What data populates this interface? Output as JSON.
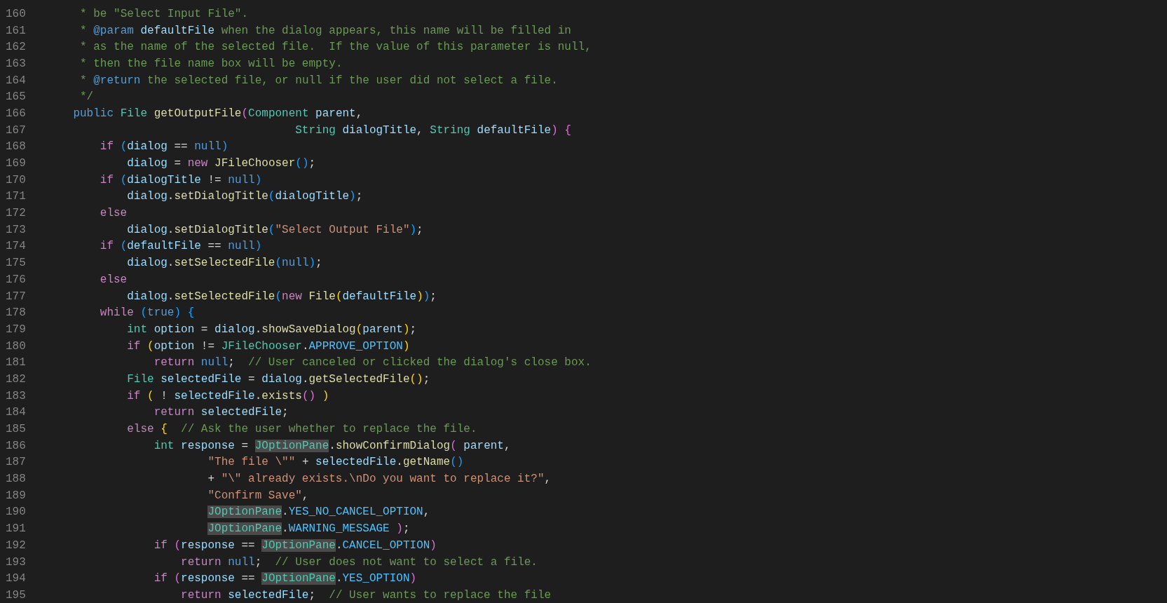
{
  "editor": {
    "lines": [
      {
        "number": "160",
        "tokens": [
          {
            "kind": "comment",
            "text": "     * be \"Select Input File\"."
          }
        ]
      },
      {
        "number": "161",
        "tokens": [
          {
            "kind": "comment",
            "text": "     * "
          },
          {
            "kind": "doc-tag",
            "text": "@param"
          },
          {
            "kind": "variable",
            "text": " defaultFile"
          },
          {
            "kind": "comment",
            "text": " when the dialog appears, this name will be filled in"
          }
        ]
      },
      {
        "number": "162",
        "tokens": [
          {
            "kind": "comment",
            "text": "     * as the name of the selected file.  If the value of this parameter is null,"
          }
        ]
      },
      {
        "number": "163",
        "tokens": [
          {
            "kind": "comment",
            "text": "     * then the file name box will be empty."
          }
        ]
      },
      {
        "number": "164",
        "tokens": [
          {
            "kind": "comment",
            "text": "     * "
          },
          {
            "kind": "doc-tag",
            "text": "@return"
          },
          {
            "kind": "comment",
            "text": " the selected file, or null if the user did not select a file."
          }
        ]
      },
      {
        "number": "165",
        "tokens": [
          {
            "kind": "comment",
            "text": "     */"
          }
        ]
      },
      {
        "number": "166",
        "tokens": [
          {
            "kind": "literal",
            "text": "    public"
          },
          {
            "kind": "type",
            "text": " File"
          },
          {
            "kind": "function",
            "text": " getOutputFile"
          },
          {
            "kind": "bracket-2",
            "text": "("
          },
          {
            "kind": "type",
            "text": "Component"
          },
          {
            "kind": "variable",
            "text": " parent"
          },
          {
            "kind": "plain",
            "text": ","
          }
        ]
      },
      {
        "number": "167",
        "tokens": [
          {
            "kind": "type",
            "text": "                                     String"
          },
          {
            "kind": "variable",
            "text": " dialogTitle"
          },
          {
            "kind": "plain",
            "text": ","
          },
          {
            "kind": "type",
            "text": " String"
          },
          {
            "kind": "variable",
            "text": " defaultFile"
          },
          {
            "kind": "bracket-2",
            "text": ")"
          },
          {
            "kind": "bracket-2",
            "text": " {"
          }
        ]
      },
      {
        "number": "168",
        "tokens": [
          {
            "kind": "keyword",
            "text": "        if"
          },
          {
            "kind": "bracket-3",
            "text": " ("
          },
          {
            "kind": "variable",
            "text": "dialog"
          },
          {
            "kind": "plain",
            "text": " == "
          },
          {
            "kind": "literal",
            "text": "null"
          },
          {
            "kind": "bracket-3",
            "text": ")"
          }
        ]
      },
      {
        "number": "169",
        "tokens": [
          {
            "kind": "variable",
            "text": "            dialog"
          },
          {
            "kind": "plain",
            "text": " = "
          },
          {
            "kind": "keyword",
            "text": "new"
          },
          {
            "kind": "function",
            "text": " JFileChooser"
          },
          {
            "kind": "bracket-3",
            "text": "()"
          },
          {
            "kind": "plain",
            "text": ";"
          }
        ]
      },
      {
        "number": "170",
        "tokens": [
          {
            "kind": "keyword",
            "text": "        if"
          },
          {
            "kind": "bracket-3",
            "text": " ("
          },
          {
            "kind": "variable",
            "text": "dialogTitle"
          },
          {
            "kind": "plain",
            "text": " != "
          },
          {
            "kind": "literal",
            "text": "null"
          },
          {
            "kind": "bracket-3",
            "text": ")"
          }
        ]
      },
      {
        "number": "171",
        "tokens": [
          {
            "kind": "variable",
            "text": "            dialog"
          },
          {
            "kind": "plain",
            "text": "."
          },
          {
            "kind": "function",
            "text": "setDialogTitle"
          },
          {
            "kind": "bracket-3",
            "text": "("
          },
          {
            "kind": "variable",
            "text": "dialogTitle"
          },
          {
            "kind": "bracket-3",
            "text": ")"
          },
          {
            "kind": "plain",
            "text": ";"
          }
        ]
      },
      {
        "number": "172",
        "tokens": [
          {
            "kind": "keyword",
            "text": "        else"
          }
        ]
      },
      {
        "number": "173",
        "tokens": [
          {
            "kind": "variable",
            "text": "            dialog"
          },
          {
            "kind": "plain",
            "text": "."
          },
          {
            "kind": "function",
            "text": "setDialogTitle"
          },
          {
            "kind": "bracket-3",
            "text": "("
          },
          {
            "kind": "string",
            "text": "\"Select Output File\""
          },
          {
            "kind": "bracket-3",
            "text": ")"
          },
          {
            "kind": "plain",
            "text": ";"
          }
        ]
      },
      {
        "number": "174",
        "tokens": [
          {
            "kind": "keyword",
            "text": "        if"
          },
          {
            "kind": "bracket-3",
            "text": " ("
          },
          {
            "kind": "variable",
            "text": "defaultFile"
          },
          {
            "kind": "plain",
            "text": " == "
          },
          {
            "kind": "literal",
            "text": "null"
          },
          {
            "kind": "bracket-3",
            "text": ")"
          }
        ]
      },
      {
        "number": "175",
        "tokens": [
          {
            "kind": "variable",
            "text": "            dialog"
          },
          {
            "kind": "plain",
            "text": "."
          },
          {
            "kind": "function",
            "text": "setSelectedFile"
          },
          {
            "kind": "bracket-3",
            "text": "("
          },
          {
            "kind": "literal",
            "text": "null"
          },
          {
            "kind": "bracket-3",
            "text": ")"
          },
          {
            "kind": "plain",
            "text": ";"
          }
        ]
      },
      {
        "number": "176",
        "tokens": [
          {
            "kind": "keyword",
            "text": "        else"
          }
        ]
      },
      {
        "number": "177",
        "tokens": [
          {
            "kind": "variable",
            "text": "            dialog"
          },
          {
            "kind": "plain",
            "text": "."
          },
          {
            "kind": "function",
            "text": "setSelectedFile"
          },
          {
            "kind": "bracket-3",
            "text": "("
          },
          {
            "kind": "keyword",
            "text": "new"
          },
          {
            "kind": "function",
            "text": " File"
          },
          {
            "kind": "bracket-1",
            "text": "("
          },
          {
            "kind": "variable",
            "text": "defaultFile"
          },
          {
            "kind": "bracket-1",
            "text": ")"
          },
          {
            "kind": "bracket-3",
            "text": ")"
          },
          {
            "kind": "plain",
            "text": ";"
          }
        ]
      },
      {
        "number": "178",
        "tokens": [
          {
            "kind": "keyword",
            "text": "        while"
          },
          {
            "kind": "bracket-3",
            "text": " ("
          },
          {
            "kind": "literal",
            "text": "true"
          },
          {
            "kind": "bracket-3",
            "text": ")"
          },
          {
            "kind": "bracket-3",
            "text": " {"
          }
        ]
      },
      {
        "number": "179",
        "tokens": [
          {
            "kind": "type",
            "text": "            int"
          },
          {
            "kind": "variable",
            "text": " option"
          },
          {
            "kind": "plain",
            "text": " = "
          },
          {
            "kind": "variable",
            "text": "dialog"
          },
          {
            "kind": "plain",
            "text": "."
          },
          {
            "kind": "function",
            "text": "showSaveDialog"
          },
          {
            "kind": "bracket-1",
            "text": "("
          },
          {
            "kind": "variable",
            "text": "parent"
          },
          {
            "kind": "bracket-1",
            "text": ")"
          },
          {
            "kind": "plain",
            "text": ";"
          }
        ]
      },
      {
        "number": "180",
        "tokens": [
          {
            "kind": "keyword",
            "text": "            if"
          },
          {
            "kind": "bracket-1",
            "text": " ("
          },
          {
            "kind": "variable",
            "text": "option"
          },
          {
            "kind": "plain",
            "text": " != "
          },
          {
            "kind": "type",
            "text": "JFileChooser"
          },
          {
            "kind": "plain",
            "text": "."
          },
          {
            "kind": "constant",
            "text": "APPROVE_OPTION"
          },
          {
            "kind": "bracket-1",
            "text": ")"
          }
        ]
      },
      {
        "number": "181",
        "tokens": [
          {
            "kind": "keyword",
            "text": "                return"
          },
          {
            "kind": "literal",
            "text": " null"
          },
          {
            "kind": "plain",
            "text": ";"
          },
          {
            "kind": "comment",
            "text": "  // User canceled or clicked the dialog's close box."
          }
        ]
      },
      {
        "number": "182",
        "tokens": [
          {
            "kind": "type",
            "text": "            File"
          },
          {
            "kind": "variable",
            "text": " selectedFile"
          },
          {
            "kind": "plain",
            "text": " = "
          },
          {
            "kind": "variable",
            "text": "dialog"
          },
          {
            "kind": "plain",
            "text": "."
          },
          {
            "kind": "function",
            "text": "getSelectedFile"
          },
          {
            "kind": "bracket-1",
            "text": "()"
          },
          {
            "kind": "plain",
            "text": ";"
          }
        ]
      },
      {
        "number": "183",
        "tokens": [
          {
            "kind": "keyword",
            "text": "            if"
          },
          {
            "kind": "bracket-1",
            "text": " ("
          },
          {
            "kind": "plain",
            "text": " ! "
          },
          {
            "kind": "variable",
            "text": "selectedFile"
          },
          {
            "kind": "plain",
            "text": "."
          },
          {
            "kind": "function",
            "text": "exists"
          },
          {
            "kind": "bracket-2",
            "text": "()"
          },
          {
            "kind": "bracket-1",
            "text": " )"
          }
        ]
      },
      {
        "number": "184",
        "tokens": [
          {
            "kind": "keyword",
            "text": "                return"
          },
          {
            "kind": "variable",
            "text": " selectedFile"
          },
          {
            "kind": "plain",
            "text": ";"
          }
        ]
      },
      {
        "number": "185",
        "tokens": [
          {
            "kind": "keyword",
            "text": "            else"
          },
          {
            "kind": "bracket-1",
            "text": " {"
          },
          {
            "kind": "comment",
            "text": "  // Ask the user whether to replace the file."
          }
        ]
      },
      {
        "number": "186",
        "tokens": [
          {
            "kind": "type",
            "text": "                int"
          },
          {
            "kind": "variable",
            "text": " response"
          },
          {
            "kind": "plain",
            "text": " = "
          },
          {
            "kind": "match",
            "text": "JOptionPane"
          },
          {
            "kind": "plain",
            "text": "."
          },
          {
            "kind": "function",
            "text": "showConfirmDialog"
          },
          {
            "kind": "bracket-2",
            "text": "("
          },
          {
            "kind": "variable",
            "text": " parent"
          },
          {
            "kind": "plain",
            "text": ","
          }
        ]
      },
      {
        "number": "187",
        "tokens": [
          {
            "kind": "string",
            "text": "                        \"The file \\\"\""
          },
          {
            "kind": "plain",
            "text": " + "
          },
          {
            "kind": "variable",
            "text": "selectedFile"
          },
          {
            "kind": "plain",
            "text": "."
          },
          {
            "kind": "function",
            "text": "getName"
          },
          {
            "kind": "bracket-3",
            "text": "()"
          }
        ]
      },
      {
        "number": "188",
        "tokens": [
          {
            "kind": "plain",
            "text": "                        + "
          },
          {
            "kind": "string",
            "text": "\"\\\" already exists.\\nDo you want to replace it?\""
          },
          {
            "kind": "plain",
            "text": ","
          }
        ]
      },
      {
        "number": "189",
        "tokens": [
          {
            "kind": "string",
            "text": "                        \"Confirm Save\""
          },
          {
            "kind": "plain",
            "text": ","
          }
        ]
      },
      {
        "number": "190",
        "tokens": [
          {
            "kind": "match",
            "text": "                        JOptionPane"
          },
          {
            "kind": "plain",
            "text": "."
          },
          {
            "kind": "constant",
            "text": "YES_NO_CANCEL_OPTION"
          },
          {
            "kind": "plain",
            "text": ","
          }
        ]
      },
      {
        "number": "191",
        "tokens": [
          {
            "kind": "match",
            "text": "                        JOptionPane"
          },
          {
            "kind": "plain",
            "text": "."
          },
          {
            "kind": "constant",
            "text": "WARNING_MESSAGE"
          },
          {
            "kind": "bracket-2",
            "text": " )"
          },
          {
            "kind": "plain",
            "text": ";"
          }
        ]
      },
      {
        "number": "192",
        "tokens": [
          {
            "kind": "keyword",
            "text": "                if"
          },
          {
            "kind": "bracket-2",
            "text": " ("
          },
          {
            "kind": "variable",
            "text": "response"
          },
          {
            "kind": "plain",
            "text": " == "
          },
          {
            "kind": "match",
            "text": "JOptionPane"
          },
          {
            "kind": "plain",
            "text": "."
          },
          {
            "kind": "constant",
            "text": "CANCEL_OPTION"
          },
          {
            "kind": "bracket-2",
            "text": ")"
          }
        ]
      },
      {
        "number": "193",
        "tokens": [
          {
            "kind": "keyword",
            "text": "                    return"
          },
          {
            "kind": "literal",
            "text": " null"
          },
          {
            "kind": "plain",
            "text": ";"
          },
          {
            "kind": "comment",
            "text": "  // User does not want to select a file."
          }
        ]
      },
      {
        "number": "194",
        "tokens": [
          {
            "kind": "keyword",
            "text": "                if"
          },
          {
            "kind": "bracket-2",
            "text": " ("
          },
          {
            "kind": "variable",
            "text": "response"
          },
          {
            "kind": "plain",
            "text": " == "
          },
          {
            "kind": "match",
            "text": "JOptionPane"
          },
          {
            "kind": "plain",
            "text": "."
          },
          {
            "kind": "constant",
            "text": "YES_OPTION"
          },
          {
            "kind": "bracket-2",
            "text": ")"
          }
        ]
      },
      {
        "number": "195",
        "tokens": [
          {
            "kind": "keyword",
            "text": "                    return"
          },
          {
            "kind": "variable",
            "text": " selectedFile"
          },
          {
            "kind": "plain",
            "text": ";"
          },
          {
            "kind": "comment",
            "text": "  // User wants to replace the file"
          }
        ]
      }
    ]
  }
}
